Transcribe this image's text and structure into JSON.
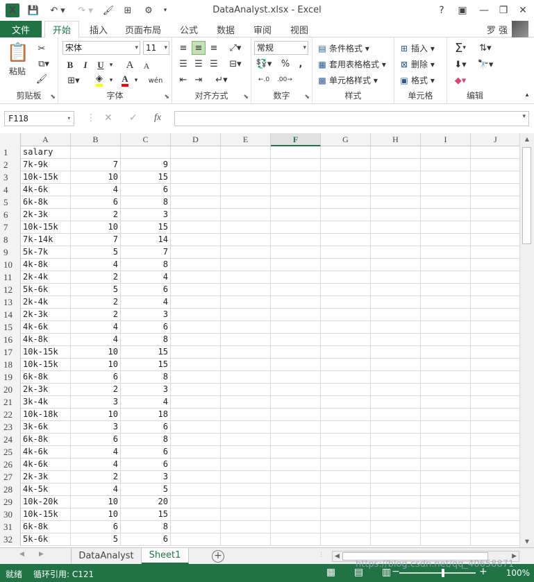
{
  "window": {
    "title": "DataAnalyst.xlsx - Excel",
    "logo": "X",
    "help": "?",
    "minimize": "—",
    "restore": "❐",
    "close": "✕"
  },
  "tabs": {
    "file": "文件",
    "items": [
      "开始",
      "插入",
      "页面布局",
      "公式",
      "数据",
      "审阅",
      "视图"
    ],
    "active": "开始",
    "user": "罗 强"
  },
  "ribbon": {
    "clipboard": {
      "label": "剪贴板",
      "paste": "粘贴"
    },
    "font": {
      "label": "字体",
      "family": "宋体",
      "size": "11",
      "bold": "B",
      "italic": "I",
      "underline": "U",
      "grow": "A",
      "shrink": "A",
      "phonetic": "wén",
      "fill_color": "#ffff00",
      "font_color": "#ff0000"
    },
    "alignment": {
      "label": "对齐方式"
    },
    "number": {
      "label": "数字",
      "format": "常规",
      "percent": "%",
      "comma": ","
    },
    "styles": {
      "label": "样式",
      "conditional": "条件格式",
      "table": "套用表格格式",
      "cell_styles": "单元格样式"
    },
    "cells": {
      "label": "单元格",
      "insert": "插入",
      "delete": "删除",
      "format": "格式"
    },
    "editing": {
      "label": "编辑",
      "sum": "Σ"
    }
  },
  "formula_bar": {
    "name_box": "F118",
    "cancel": "✕",
    "enter": "✓",
    "fx": "fx",
    "content": ""
  },
  "grid": {
    "columns": [
      "A",
      "B",
      "C",
      "D",
      "E",
      "F",
      "G",
      "H",
      "I",
      "J"
    ],
    "selected_column": "F",
    "rows": [
      [
        "1",
        "salary",
        "",
        ""
      ],
      [
        "2",
        "7k-9k",
        "7",
        "9"
      ],
      [
        "3",
        "10k-15k",
        "10",
        "15"
      ],
      [
        "4",
        "4k-6k",
        "4",
        "6"
      ],
      [
        "5",
        "6k-8k",
        "6",
        "8"
      ],
      [
        "6",
        "2k-3k",
        "2",
        "3"
      ],
      [
        "7",
        "10k-15k",
        "10",
        "15"
      ],
      [
        "8",
        "7k-14k",
        "7",
        "14"
      ],
      [
        "9",
        "5k-7k",
        "5",
        "7"
      ],
      [
        "10",
        "4k-8k",
        "4",
        "8"
      ],
      [
        "11",
        "2k-4k",
        "2",
        "4"
      ],
      [
        "12",
        "5k-6k",
        "5",
        "6"
      ],
      [
        "13",
        "2k-4k",
        "2",
        "4"
      ],
      [
        "14",
        "2k-3k",
        "2",
        "3"
      ],
      [
        "15",
        "4k-6k",
        "4",
        "6"
      ],
      [
        "16",
        "4k-8k",
        "4",
        "8"
      ],
      [
        "17",
        "10k-15k",
        "10",
        "15"
      ],
      [
        "18",
        "10k-15k",
        "10",
        "15"
      ],
      [
        "19",
        "6k-8k",
        "6",
        "8"
      ],
      [
        "20",
        "2k-3k",
        "2",
        "3"
      ],
      [
        "21",
        "3k-4k",
        "3",
        "4"
      ],
      [
        "22",
        "10k-18k",
        "10",
        "18"
      ],
      [
        "23",
        "3k-6k",
        "3",
        "6"
      ],
      [
        "24",
        "6k-8k",
        "6",
        "8"
      ],
      [
        "25",
        "4k-6k",
        "4",
        "6"
      ],
      [
        "26",
        "4k-6k",
        "4",
        "6"
      ],
      [
        "27",
        "2k-3k",
        "2",
        "3"
      ],
      [
        "28",
        "4k-5k",
        "4",
        "5"
      ],
      [
        "29",
        "10k-20k",
        "10",
        "20"
      ],
      [
        "30",
        "10k-15k",
        "10",
        "15"
      ],
      [
        "31",
        "6k-8k",
        "6",
        "8"
      ],
      [
        "32",
        "5k-6k",
        "5",
        "6"
      ]
    ]
  },
  "sheets": {
    "items": [
      "DataAnalyst",
      "Sheet1"
    ],
    "active": "Sheet1",
    "add": "+"
  },
  "status": {
    "ready": "就绪",
    "circular": "循环引用: C121",
    "zoom": "100%",
    "watermark": "https://blog.csdn.net/qq_40658871"
  },
  "colors": {
    "accent": "#217346"
  }
}
